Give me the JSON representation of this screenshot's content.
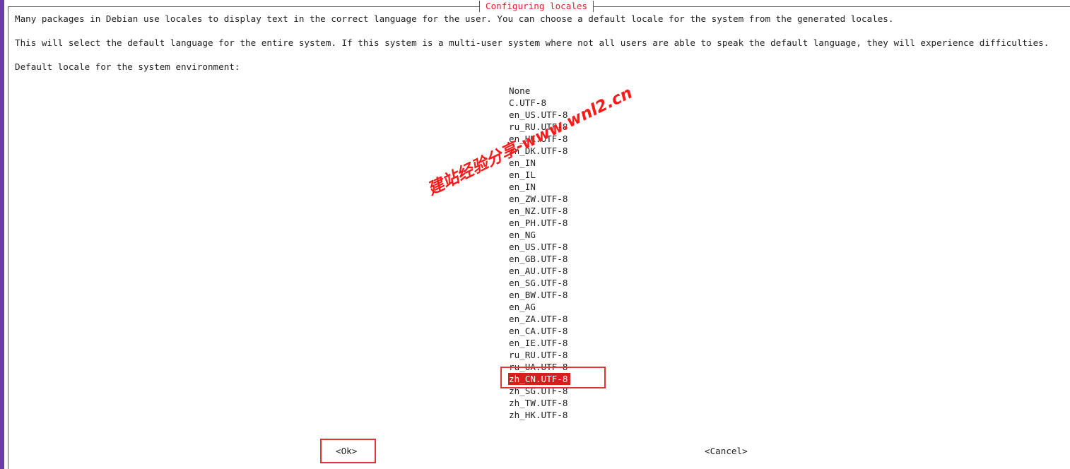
{
  "dialog": {
    "title": "Configuring locales",
    "paragraph1": "Many packages in Debian use locales to display text in the correct language for the user. You can choose a default locale for the system from the generated locales.",
    "paragraph2": "This will select the default language for the entire system. If this system is a multi-user system where not all users are able to speak the default language, they will experience difficulties.",
    "prompt": "Default locale for the system environment:"
  },
  "locales": {
    "items": [
      "None",
      "C.UTF-8",
      "en_US.UTF-8",
      "ru_RU.UTF-8",
      "en_HK.UTF-8",
      "en_DK.UTF-8",
      "en_IN",
      "en_IL",
      "en_IN",
      "en_ZW.UTF-8",
      "en_NZ.UTF-8",
      "en_PH.UTF-8",
      "en_NG",
      "en_US.UTF-8",
      "en_GB.UTF-8",
      "en_AU.UTF-8",
      "en_SG.UTF-8",
      "en_BW.UTF-8",
      "en_AG",
      "en_ZA.UTF-8",
      "en_CA.UTF-8",
      "en_IE.UTF-8",
      "ru_RU.UTF-8",
      "ru_UA.UTF-8",
      "zh_CN.UTF-8",
      "zh_SG.UTF-8",
      "zh_TW.UTF-8",
      "zh_HK.UTF-8"
    ],
    "selected_index": 24
  },
  "buttons": {
    "ok": "<Ok>",
    "cancel": "<Cancel>"
  },
  "watermark": "建站经验分享-www.wnl2.cn",
  "colors": {
    "accent_red": "#d51f1f",
    "title_red": "#d8262f",
    "annotation_red": "#e23434",
    "left_strip": "#6b3fa0"
  }
}
